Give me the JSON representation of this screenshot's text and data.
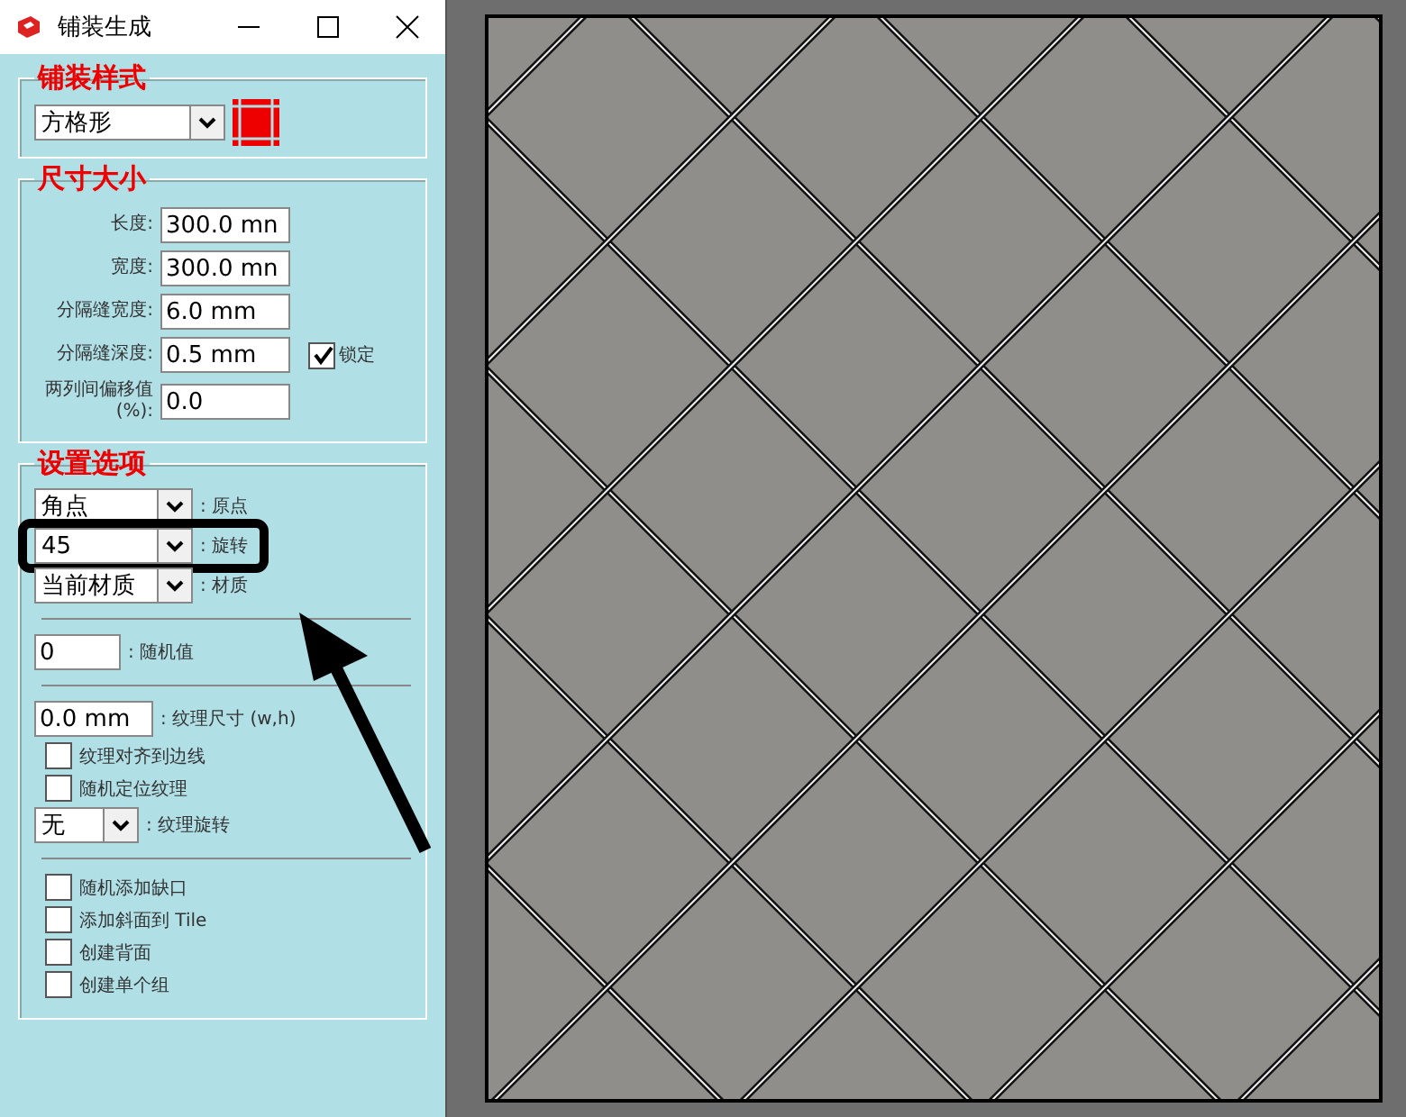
{
  "window": {
    "title": "铺装生成"
  },
  "paving_style": {
    "heading": "铺装样式",
    "dropdown": "方格形"
  },
  "dimensions": {
    "heading": "尺寸大小",
    "fields": [
      {
        "label": "长度:",
        "value": "300.0 mn"
      },
      {
        "label": "宽度:",
        "value": "300.0 mn"
      },
      {
        "label": "分隔缝宽度:",
        "value": "6.0 mm"
      },
      {
        "label": "分隔缝深度:",
        "value": "0.5 mm",
        "lock": {
          "label": "锁定",
          "checked": true
        }
      },
      {
        "label": "两列间偏移值(%):",
        "value": "0.0"
      }
    ]
  },
  "options": {
    "heading": "设置选项",
    "dropdowns": [
      {
        "value": "角点",
        "label": ": 原点",
        "highlighted": false
      },
      {
        "value": "45",
        "label": ": 旋转",
        "highlighted": true
      },
      {
        "value": "当前材质",
        "label": ": 材质",
        "highlighted": false
      }
    ],
    "random": {
      "value": "0",
      "label": ": 随机值"
    },
    "texture_size": {
      "value": "0.0 mm",
      "label": ": 纹理尺寸 (w,h)"
    },
    "texture_checks": [
      {
        "label": "纹理对齐到边线",
        "checked": false
      },
      {
        "label": "随机定位纹理",
        "checked": false
      }
    ],
    "texture_rotation": {
      "value": "无",
      "label": ": 纹理旋转"
    },
    "checks": [
      {
        "label": "随机添加缺口",
        "checked": false
      },
      {
        "label": "添加斜面到 Tile",
        "checked": false
      },
      {
        "label": "创建背面",
        "checked": false
      },
      {
        "label": "创建单个组",
        "checked": false
      }
    ]
  }
}
